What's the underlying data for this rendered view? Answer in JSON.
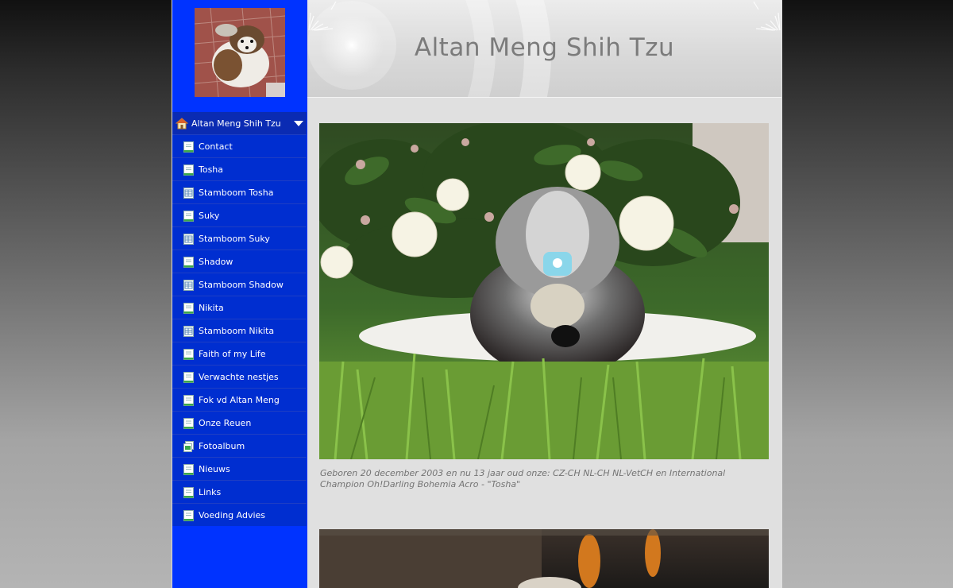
{
  "site": {
    "title": "Altan Meng Shih Tzu"
  },
  "nav": {
    "home_label": "Altan Meng Shih Tzu",
    "items": [
      {
        "label": "Contact",
        "icon": "page-icon"
      },
      {
        "label": "Tosha",
        "icon": "page-icon"
      },
      {
        "label": "Stamboom Tosha",
        "icon": "table-page-icon"
      },
      {
        "label": "Suky",
        "icon": "page-icon"
      },
      {
        "label": "Stamboom Suky",
        "icon": "table-page-icon"
      },
      {
        "label": "Shadow",
        "icon": "page-icon"
      },
      {
        "label": "Stamboom Shadow",
        "icon": "table-page-icon"
      },
      {
        "label": "Nikita",
        "icon": "page-icon"
      },
      {
        "label": "Stamboom Nikita",
        "icon": "table-page-icon"
      },
      {
        "label": "Faith of my Life",
        "icon": "page-icon"
      },
      {
        "label": "Verwachte nestjes",
        "icon": "page-icon"
      },
      {
        "label": "Fok vd Altan Meng",
        "icon": "page-icon"
      },
      {
        "label": "Onze Reuen",
        "icon": "page-icon"
      },
      {
        "label": "Fotoalbum",
        "icon": "photo-album-icon"
      },
      {
        "label": "Nieuws",
        "icon": "page-icon"
      },
      {
        "label": "Links",
        "icon": "page-icon"
      },
      {
        "label": "Voeding Advies",
        "icon": "page-icon"
      }
    ]
  },
  "content": {
    "caption": "Geboren 20 december 2003 en nu 13 jaar oud onze: CZ-CH NL-CH NL-VetCH en International Champion Oh!Darling Bohemia Acro - \"Tosha\""
  },
  "colors": {
    "sidebar": "#0033ff",
    "menu_item": "#002ed0",
    "menu_home": "#0a2bb3",
    "title": "#7b7b7b"
  }
}
